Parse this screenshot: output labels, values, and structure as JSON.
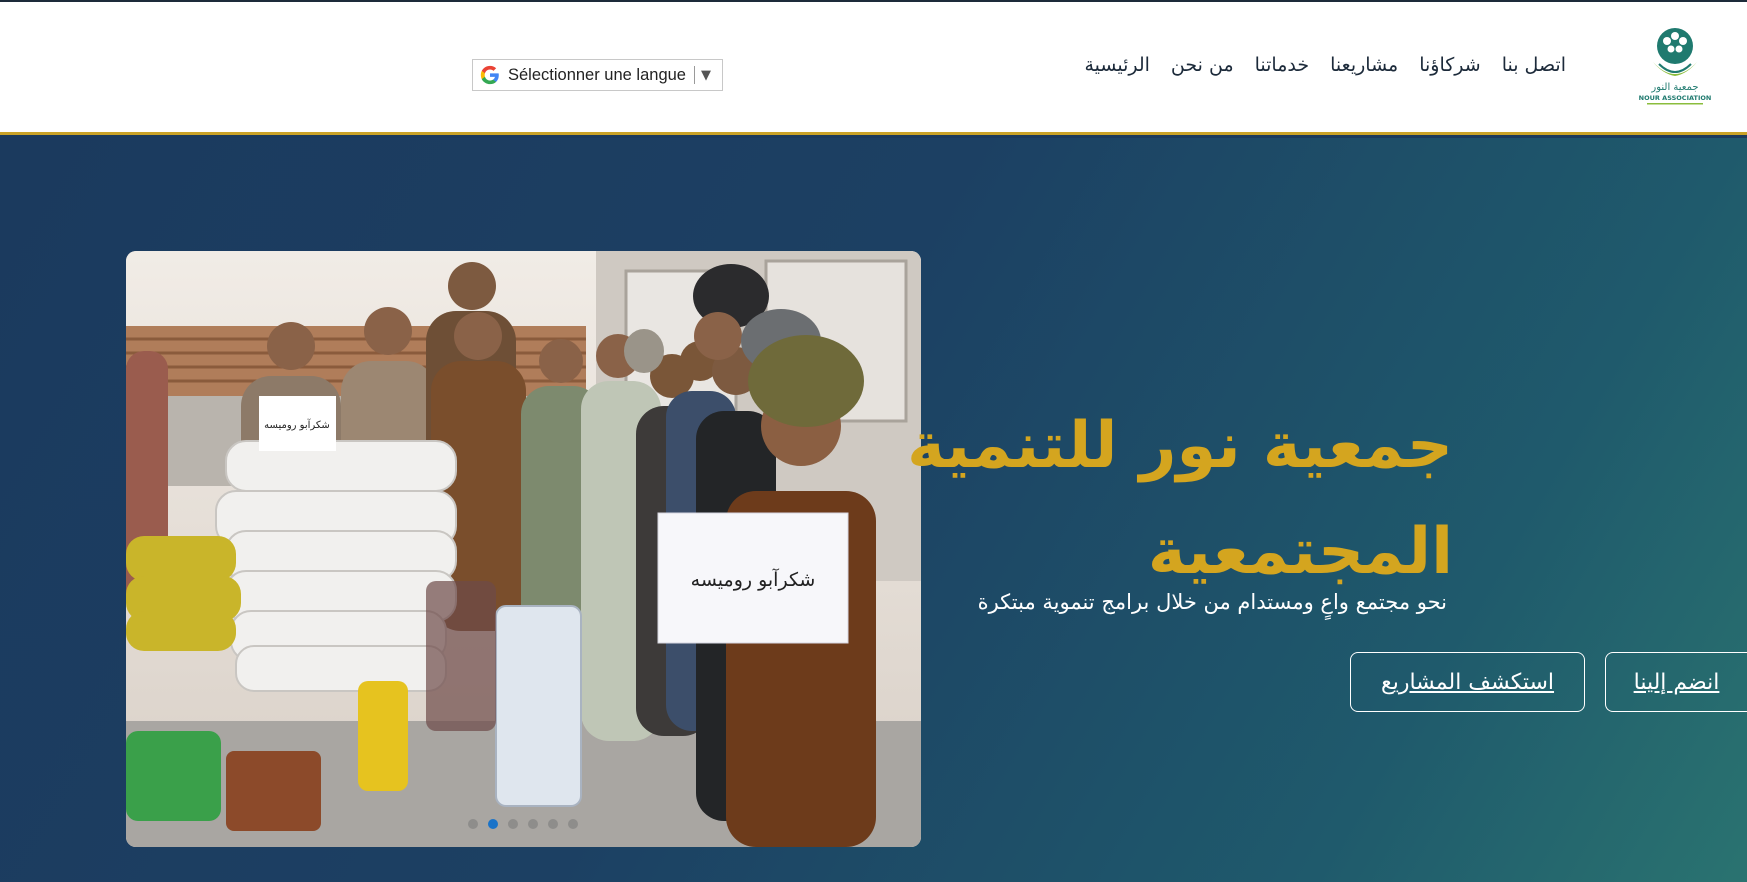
{
  "header": {
    "logo_text": "جمعية النور",
    "logo_subtext": "NOUR ASSOCIATION",
    "nav": [
      {
        "label": "الرئيسية"
      },
      {
        "label": "من نحن"
      },
      {
        "label": "خدماتنا"
      },
      {
        "label": "مشاريعنا"
      },
      {
        "label": "شركاؤنا"
      },
      {
        "label": "اتصل بنا"
      }
    ],
    "language_selector": {
      "label": "Sélectionner une langue",
      "icon": "google-g-icon",
      "arrow": "▼"
    }
  },
  "hero": {
    "title": "جمعية نور للتنمية المجتمعية",
    "subtitle": "نحو مجتمع واعٍ ومستدام من خلال برامج تنموية مبتكرة",
    "buttons": {
      "join": "انضم إلينا",
      "explore": "استكشف المشاريع"
    },
    "carousel": {
      "slide_count": 6,
      "active_index": 1,
      "sign_text": "شكرآبو روميسه"
    }
  },
  "colors": {
    "accent": "#d4a51f",
    "hero_bg": "#1b3a5e",
    "header_border": "#c9a227",
    "active_dot": "#1a73c8"
  }
}
